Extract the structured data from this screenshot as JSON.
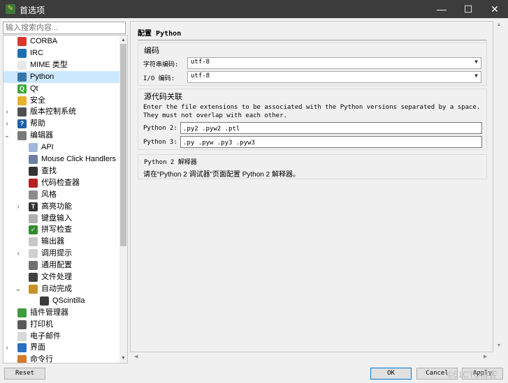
{
  "window": {
    "title": "首选项",
    "controls": {
      "minimize": "—",
      "maximize": "☐",
      "close": "✕"
    }
  },
  "search": {
    "placeholder": "输入搜索内容..."
  },
  "tree": {
    "items": [
      {
        "label": "CORBA",
        "icon": "corba-icon",
        "level": 0,
        "color": "#d9372c",
        "glyph": ""
      },
      {
        "label": "IRC",
        "icon": "irc-icon",
        "level": 0,
        "color": "#1d6fb5",
        "glyph": ""
      },
      {
        "label": "MIME 类型",
        "icon": "mime-icon",
        "level": 0,
        "color": "#e8e8e8",
        "glyph": ""
      },
      {
        "label": "Python",
        "icon": "python-icon",
        "level": 0,
        "color": "#3776ab",
        "glyph": "",
        "selected": true
      },
      {
        "label": "Qt",
        "icon": "qt-icon",
        "level": 0,
        "color": "#41a63a",
        "glyph": "Q"
      },
      {
        "label": "安全",
        "icon": "lock-icon",
        "level": 0,
        "color": "#e5b22a",
        "glyph": ""
      },
      {
        "label": "版本控制系统",
        "icon": "vcs-icon",
        "level": 0,
        "color": "#505050",
        "glyph": "",
        "arrow": "›"
      },
      {
        "label": "帮助",
        "icon": "help-icon",
        "level": 0,
        "color": "#1d5fa8",
        "glyph": "?",
        "arrow": "›"
      },
      {
        "label": "编辑器",
        "icon": "editor-icon",
        "level": 0,
        "color": "#7a7a7a",
        "glyph": "",
        "arrow": "⌄"
      },
      {
        "label": "API",
        "icon": "api-icon",
        "level": 1,
        "color": "#a0b8d8",
        "glyph": ""
      },
      {
        "label": "Mouse Click Handlers",
        "icon": "mouse-icon",
        "level": 1,
        "color": "#6b7fa0",
        "glyph": ""
      },
      {
        "label": "查找",
        "icon": "binoculars-icon",
        "level": 1,
        "color": "#333333",
        "glyph": ""
      },
      {
        "label": "代码检查器",
        "icon": "bug-icon",
        "level": 1,
        "color": "#b52020",
        "glyph": ""
      },
      {
        "label": "风格",
        "icon": "style-icon",
        "level": 1,
        "color": "#8c8c8c",
        "glyph": ""
      },
      {
        "label": "高亮功能",
        "icon": "highlight-icon",
        "level": 1,
        "color": "#333333",
        "glyph": "T",
        "arrow": "›"
      },
      {
        "label": "键盘输入",
        "icon": "keyboard-icon",
        "level": 1,
        "color": "#b0b0b0",
        "glyph": ""
      },
      {
        "label": "拼写检查",
        "icon": "spellcheck-icon",
        "level": 1,
        "color": "#2e8b2e",
        "glyph": "✓"
      },
      {
        "label": "输出器",
        "icon": "exporter-icon",
        "level": 1,
        "color": "#c8c8c8",
        "glyph": ""
      },
      {
        "label": "调用提示",
        "icon": "calltip-icon",
        "level": 1,
        "color": "#d0d0d0",
        "glyph": "",
        "arrow": "›"
      },
      {
        "label": "通用配置",
        "icon": "general-icon",
        "level": 1,
        "color": "#707070",
        "glyph": ""
      },
      {
        "label": "文件处理",
        "icon": "save-icon",
        "level": 1,
        "color": "#404040",
        "glyph": ""
      },
      {
        "label": "自动完成",
        "icon": "autocomplete-icon",
        "level": 1,
        "color": "#c8922a",
        "glyph": "",
        "arrow": "⌄"
      },
      {
        "label": "QScintilla",
        "icon": "qscintilla-icon",
        "level": 2,
        "color": "#3a3a3a",
        "glyph": ""
      },
      {
        "label": "插件管理器",
        "icon": "plugin-icon",
        "level": 0,
        "color": "#3f9b3f",
        "glyph": ""
      },
      {
        "label": "打印机",
        "icon": "printer-icon",
        "level": 0,
        "color": "#5a5a5a",
        "glyph": ""
      },
      {
        "label": "电子邮件",
        "icon": "email-icon",
        "level": 0,
        "color": "#d8d8d8",
        "glyph": ""
      },
      {
        "label": "界面",
        "icon": "interface-icon",
        "level": 0,
        "color": "#2a6fc2",
        "glyph": "",
        "arrow": "›"
      },
      {
        "label": "命令行",
        "icon": "shell-icon",
        "level": 0,
        "color": "#d47a2a",
        "glyph": ""
      }
    ]
  },
  "page": {
    "title": "配置 Python",
    "encoding": {
      "group_title": "编码",
      "string_label": "字符串编码:",
      "string_value": "utf-8",
      "io_label": "I/O 编码:",
      "io_value": "utf-8"
    },
    "assoc": {
      "group_title": "源代码关联",
      "description": "Enter the file extensions to be associated with the Python versions separated by a space. They must not overlap with each other.",
      "py2_label": "Python 2:",
      "py2_value": ".py2 .pyw2 .ptl",
      "py3_label": "Python 3:",
      "py3_value": ".py .pyw .py3 .pyw3"
    },
    "interpreter": {
      "group_title": "Python 2 解释器",
      "text": "请在“Python 2 调试器”页面配置 Python 2 解释器。"
    }
  },
  "buttons": {
    "reset": "Reset",
    "ok": "OK",
    "cancel": "Cancel",
    "apply": "Apply"
  },
  "watermark": "©51CTO博客"
}
